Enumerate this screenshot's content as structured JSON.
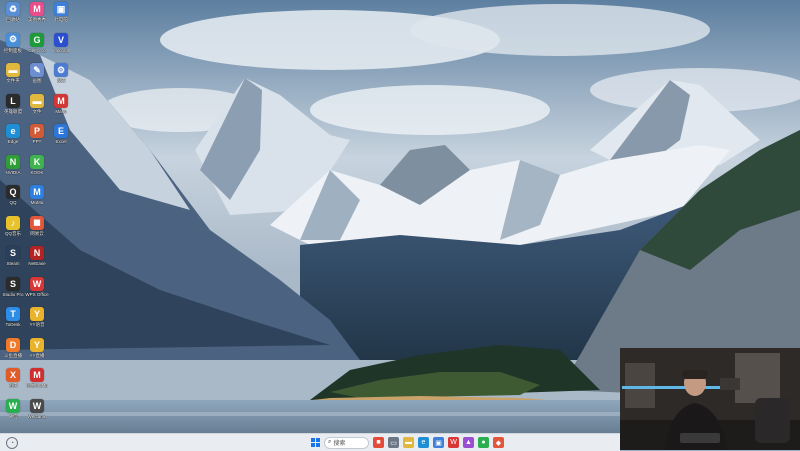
{
  "desktop": {
    "icons": [
      {
        "label": "回收站",
        "icon": "recycle-bin-icon",
        "color": "#5a8fd6",
        "glyph": "♻"
      },
      {
        "label": "美图秀秀",
        "icon": "meitu-icon",
        "color": "#e94d8a",
        "glyph": "M"
      },
      {
        "label": "此电脑",
        "icon": "this-pc-icon",
        "color": "#3d7fd9",
        "glyph": "▣"
      },
      {
        "label": "控制面板",
        "icon": "control-panel-icon",
        "color": "#4b8ed8",
        "glyph": "⚙"
      },
      {
        "label": "GeForce",
        "icon": "geforce-icon",
        "color": "#1e9a3a",
        "glyph": "G"
      },
      {
        "label": "Valorant",
        "icon": "game-icon",
        "color": "#2c4fd0",
        "glyph": "V"
      },
      {
        "label": "文件夹",
        "icon": "folder-icon",
        "color": "#e0b840",
        "glyph": "▬"
      },
      {
        "label": "画图",
        "icon": "paint-icon",
        "color": "#6d8fd2",
        "glyph": "✎"
      },
      {
        "label": "设置",
        "icon": "settings-icon",
        "color": "#4c7bd1",
        "glyph": "⚙"
      },
      {
        "label": "英雄联盟",
        "icon": "lol-icon",
        "color": "#2b2b2b",
        "glyph": "L"
      },
      {
        "label": "文件",
        "icon": "folder-icon",
        "color": "#e0b840",
        "glyph": "▬"
      },
      {
        "label": "Mario",
        "icon": "mario-icon",
        "color": "#d33636",
        "glyph": "M"
      },
      {
        "label": "Edge",
        "icon": "edge-icon",
        "color": "#1f8fd5",
        "glyph": "e"
      },
      {
        "label": "PPT",
        "icon": "ppt-icon",
        "color": "#d25a37",
        "glyph": "P"
      },
      {
        "label": "Excel",
        "icon": "excel-icon",
        "color": "#2c76d9",
        "glyph": "E"
      },
      {
        "label": "NVIDIA",
        "icon": "nvidia-icon",
        "color": "#2f9e36",
        "glyph": "N"
      },
      {
        "label": "KOOK",
        "icon": "kook-icon",
        "color": "#3fb34f",
        "glyph": "K"
      },
      {
        "label": "QQ",
        "icon": "qq-icon",
        "color": "#2b2b2b",
        "glyph": "Q"
      },
      {
        "label": "MuMu",
        "icon": "mumu-icon",
        "color": "#2f7fe0",
        "glyph": "M"
      },
      {
        "label": "QQ音乐",
        "icon": "qqmusic-icon",
        "color": "#e8c22c",
        "glyph": "♪"
      },
      {
        "label": "网易云",
        "icon": "app-icon",
        "color": "#e2563b",
        "glyph": "◼"
      },
      {
        "label": "Steam",
        "icon": "steam-icon",
        "color": "#2a3f5a",
        "glyph": "S"
      },
      {
        "label": "NetEase",
        "icon": "netease-icon",
        "color": "#b42323",
        "glyph": "N"
      },
      {
        "label": "Studio Pro",
        "icon": "studio-icon",
        "color": "#2b2b2b",
        "glyph": "S"
      },
      {
        "label": "WPS Office",
        "icon": "wps-icon",
        "color": "#d93636",
        "glyph": "W"
      },
      {
        "label": "ToDesk",
        "icon": "todesk-icon",
        "color": "#2d8de6",
        "glyph": "T"
      },
      {
        "label": "YY语音",
        "icon": "yy-icon",
        "color": "#e9b42b",
        "glyph": "Y"
      },
      {
        "label": "斗鱼直播",
        "icon": "douyu-icon",
        "color": "#f07a2a",
        "glyph": "D"
      },
      {
        "label": "YY直播",
        "icon": "yy-live-icon",
        "color": "#e9b42b",
        "glyph": "Y"
      },
      {
        "label": "迅雷",
        "icon": "xunlei-icon",
        "color": "#e05a2a",
        "glyph": "X"
      },
      {
        "label": "网易MuMu",
        "icon": "mumu2-icon",
        "color": "#d12f2f",
        "glyph": "M"
      },
      {
        "label": "微信",
        "icon": "wechat-icon",
        "color": "#2aae4f",
        "glyph": "W"
      },
      {
        "label": "WeGame",
        "icon": "wegame-icon",
        "color": "#4a4a4a",
        "glyph": "W"
      }
    ]
  },
  "taskbar": {
    "search_placeholder": "搜索",
    "apps": [
      {
        "name": "games-icon",
        "color": "#e34b3b",
        "glyph": "■"
      },
      {
        "name": "task-view-icon",
        "color": "#6b7785",
        "glyph": "▭"
      },
      {
        "name": "file-explorer-icon",
        "color": "#e0b840",
        "glyph": "▬"
      },
      {
        "name": "edge-icon",
        "color": "#1f8fd5",
        "glyph": "e"
      },
      {
        "name": "store-icon",
        "color": "#3d7fd9",
        "glyph": "▣"
      },
      {
        "name": "wps-icon",
        "color": "#d93636",
        "glyph": "W"
      },
      {
        "name": "photos-icon",
        "color": "#9a4fd3",
        "glyph": "▲"
      },
      {
        "name": "wechat-icon",
        "color": "#2aae4f",
        "glyph": "●"
      },
      {
        "name": "app-icon",
        "color": "#e2563b",
        "glyph": "◆"
      }
    ]
  },
  "webcam": {
    "label": "webcam-overlay"
  }
}
